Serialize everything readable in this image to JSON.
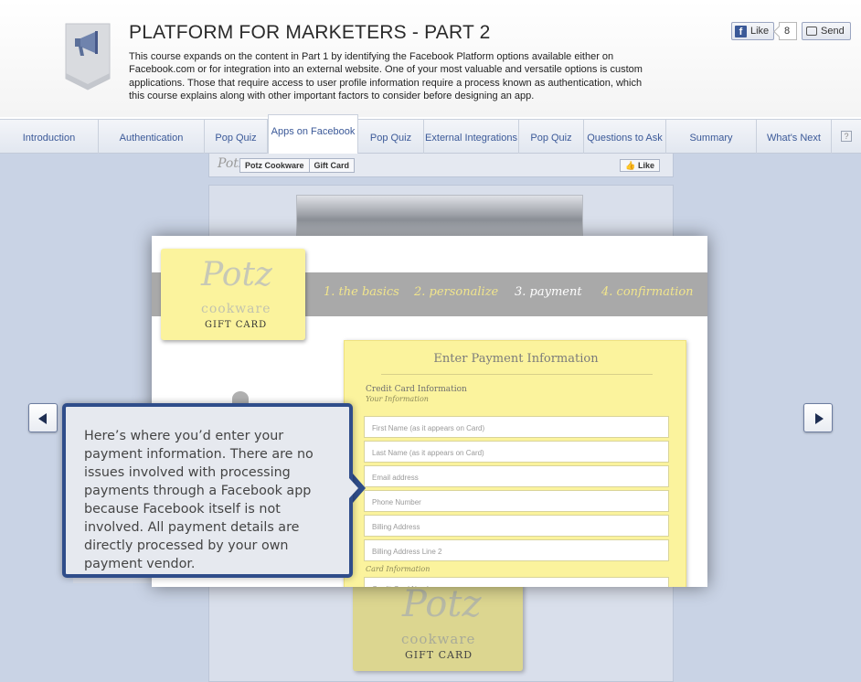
{
  "header": {
    "title": "PLATFORM FOR MARKETERS - PART 2",
    "description": "This course expands on the content in Part 1 by identifying the Facebook Platform options available either on Facebook.com or for integration into an external website. One of your most valuable and versatile options is custom applications. Those that require access to user profile information require a process known as authentication, which this course explains along with other important factors to consider before designing an app.",
    "icon": "megaphone-icon",
    "like_label": "Like",
    "like_count": "8",
    "send_label": "Send"
  },
  "tabs": [
    {
      "label": "Introduction",
      "active": false
    },
    {
      "label": "Authentication",
      "active": false
    },
    {
      "label": "Pop Quiz",
      "active": false
    },
    {
      "label": "Apps on Facebook",
      "active": true
    },
    {
      "label": "Pop Quiz",
      "active": false
    },
    {
      "label": "External Integrations",
      "active": false
    },
    {
      "label": "Pop Quiz",
      "active": false
    },
    {
      "label": "Questions to Ask",
      "active": false
    },
    {
      "label": "Summary",
      "active": false
    },
    {
      "label": "What's Next",
      "active": false
    }
  ],
  "help_label": "?",
  "background_page": {
    "logo": "Potz",
    "breadcrumb": [
      "Potz Cookware",
      "Gift Card"
    ],
    "like_label": "Like",
    "gift_card": {
      "logo": "Potz",
      "brand": "cookware",
      "label": "GIFT CARD"
    }
  },
  "modal": {
    "gift_card": {
      "logo": "Potz",
      "brand": "cookware",
      "label": "GIFT CARD"
    },
    "steps": [
      "1. the basics",
      "2. personalize",
      "3. payment",
      "4. confirmation"
    ],
    "current_step": "3. payment",
    "form": {
      "title": "Enter Payment Information",
      "section_title": "Credit Card Information",
      "section_subtitle": "Your Information",
      "fields": [
        "First Name (as it appears on Card)",
        "Last Name (as it appears on Card)",
        "Email address",
        "Phone Number",
        "Billing Address",
        "Billing Address Line 2"
      ],
      "card_section": "Card Information",
      "card_number_placeholder": "Credit Card Number"
    }
  },
  "callout": {
    "text": "Here’s where you’d enter your payment information. There are no issues involved with processing payments through a Facebook app because Facebook itself is not involved. All payment details are directly processed by your own payment vendor."
  },
  "colors": {
    "facebook_blue": "#3b5998",
    "callout_border": "#2f4d8a",
    "gift_card_yellow": "#fbf39d",
    "content_bg": "#c9d3e5"
  }
}
